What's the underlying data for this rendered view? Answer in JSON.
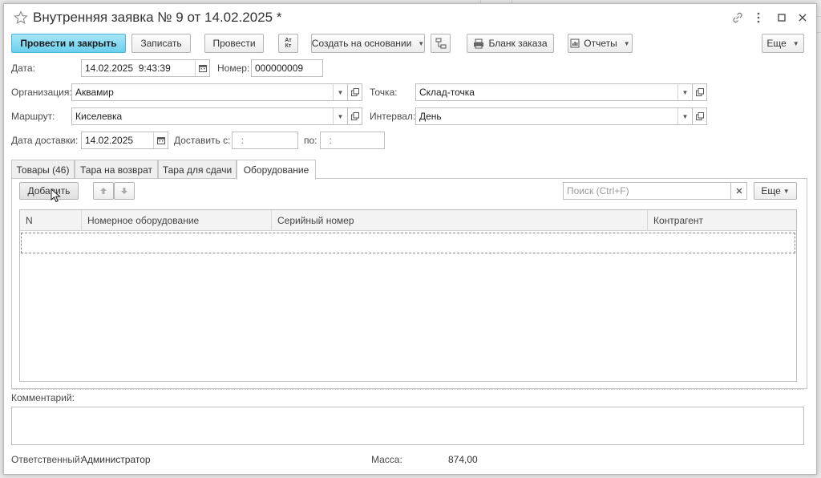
{
  "window": {
    "title": "Внутренняя заявка № 9 от 14.02.2025 *"
  },
  "toolbar": {
    "post_close": "Провести и закрыть",
    "save": "Записать",
    "post": "Провести",
    "dtkt": "Ат Кт",
    "create_based": "Создать на основании",
    "order_form": "Бланк заказа",
    "reports": "Отчеты",
    "more": "Еще"
  },
  "header_fields": {
    "date_label": "Дата:",
    "date_value": "14.02.2025  9:43:39",
    "number_label": "Номер:",
    "number_value": "000000009",
    "org_label": "Организация:",
    "org_value": "Аквамир",
    "point_label": "Точка:",
    "point_value": "Склад-точка",
    "route_label": "Маршрут:",
    "route_value": "Киселевка",
    "interval_label": "Интервал:",
    "interval_value": "День",
    "delivery_date_label": "Дата доставки:",
    "delivery_date_value": "14.02.2025",
    "deliver_from_label": "Доставить с:",
    "deliver_from_value": "  :",
    "deliver_to_label": "по:",
    "deliver_to_value": "  :"
  },
  "tabs": [
    {
      "label": "Товары (46)"
    },
    {
      "label": "Тара на возврат"
    },
    {
      "label": "Тара для сдачи"
    },
    {
      "label": "Оборудование"
    }
  ],
  "equipment": {
    "add_button": "Добавить",
    "search_placeholder": "Поиск (Ctrl+F)",
    "more": "Еще",
    "columns": [
      "N",
      "Номерное оборудование",
      "Серийный номер",
      "Контрагент"
    ]
  },
  "footer": {
    "comment_label": "Комментарий:",
    "responsible_label": "Ответственный:",
    "responsible_value": "Администратор",
    "mass_label": "Масса:",
    "mass_value": "874,00"
  },
  "colors": {
    "primary_button": "#6bcfee",
    "border": "#bdbdbd"
  }
}
